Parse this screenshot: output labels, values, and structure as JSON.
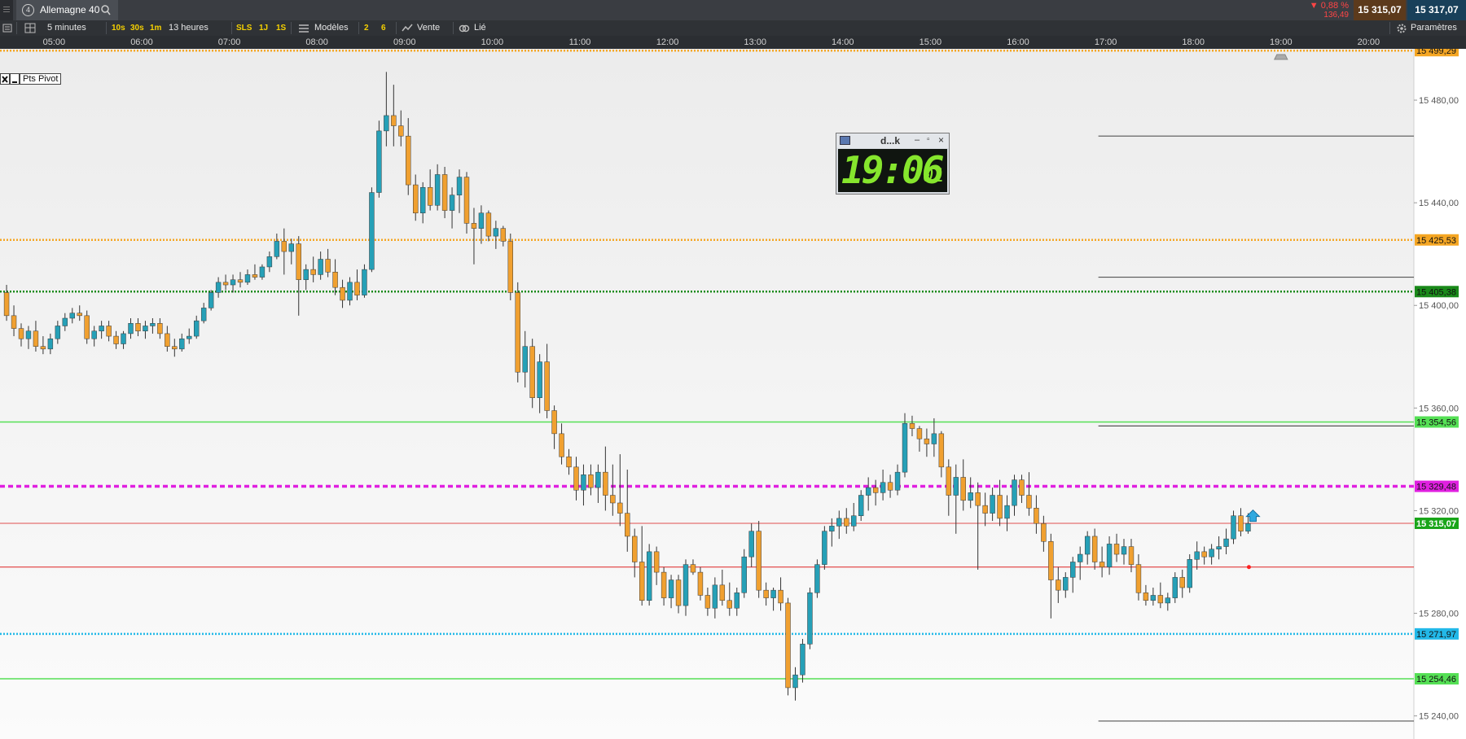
{
  "window": {
    "tab_number": "4",
    "instrument": "Allemagne 40",
    "change_percent": "▼ 0,88 %",
    "change_points": "136,49",
    "bid": "15 315,07",
    "ask": "15 317,07"
  },
  "toolbar": {
    "timeframe": "5 minutes",
    "quick_10s": "10s",
    "quick_30s": "30s",
    "quick_1m": "1m",
    "period": "13 heures",
    "sls": "SLS",
    "one_day": "1J",
    "one_s": "1S",
    "templates": "Modèles",
    "badge_2": "2",
    "badge_6": "6",
    "sell": "Vente",
    "linked": "Lié",
    "settings": "Paramètres"
  },
  "overlays": {
    "pivot_label": "Pts Pivot",
    "clock_title": "d...k",
    "clock_time": "19:06",
    "clock_seconds": "01"
  },
  "colors": {
    "bull": "#26a0b7",
    "bear": "#f0a030",
    "wick": "#333333",
    "background": "#f2f2f2",
    "axis_bg": "#2b2e32"
  },
  "chart_data": {
    "type": "candlestick",
    "instrument": "Allemagne 40",
    "interval": "5 minutes",
    "x_ticks": [
      "05:00",
      "06:00",
      "07:00",
      "08:00",
      "09:00",
      "10:00",
      "11:00",
      "12:00",
      "13:00",
      "14:00",
      "15:00",
      "16:00",
      "17:00",
      "18:00",
      "19:00",
      "20:00"
    ],
    "y_ticks": [
      15480,
      15440,
      15400,
      15360,
      15320,
      15280,
      15240
    ],
    "y_tick_labels": [
      "15 480,00",
      "15 440,00",
      "15 400,00",
      "15 360,00",
      "15 320,00",
      "15 280,00",
      "15 240,00"
    ],
    "ylim": [
      15231,
      15500
    ],
    "xlim": [
      "04:23",
      "20:31"
    ],
    "grid": false,
    "current_price": {
      "value": 15315.07,
      "label": "15 315,07",
      "color": "#19a519"
    },
    "levels": [
      {
        "value": 15499.29,
        "label": "15 499,29",
        "color": "#f5a623",
        "style": "dotted"
      },
      {
        "value": 15425.53,
        "label": "15 425,53",
        "color": "#f5a623",
        "style": "dotted"
      },
      {
        "value": 15405.38,
        "label": "15 405,38",
        "color": "#1a8a1a",
        "style": "dotted"
      },
      {
        "value": 15354.56,
        "label": "15 354,56",
        "color": "#55e055",
        "style": "solid"
      },
      {
        "value": 15329.48,
        "label": "15 329,48",
        "color": "#e020e0",
        "style": "dashed"
      },
      {
        "value": 15271.97,
        "label": "15 271,97",
        "color": "#22b8e8",
        "style": "dotted"
      },
      {
        "value": 15254.46,
        "label": "15 254,46",
        "color": "#55e055",
        "style": "solid"
      }
    ],
    "unlabeled_lines": [
      {
        "value": 15298,
        "color": "#dd2222"
      }
    ],
    "session_lines": [
      {
        "value": 15466,
        "from": "16:55",
        "to": "20:31"
      },
      {
        "value": 15411,
        "from": "16:55",
        "to": "20:31"
      },
      {
        "value": 15353,
        "from": "16:55",
        "to": "20:31"
      },
      {
        "value": 15238,
        "from": "16:55",
        "to": "20:31"
      }
    ],
    "ohlc": [
      [
        "04:25",
        15405,
        15408,
        15394,
        15396
      ],
      [
        "04:30",
        15396,
        15400,
        15388,
        15391
      ],
      [
        "04:35",
        15391,
        15393,
        15384,
        15387
      ],
      [
        "04:40",
        15387,
        15392,
        15383,
        15390
      ],
      [
        "04:45",
        15390,
        15394,
        15382,
        15384
      ],
      [
        "04:50",
        15384,
        15388,
        15381,
        15383
      ],
      [
        "04:55",
        15383,
        15389,
        15381,
        15387
      ],
      [
        "05:00",
        15387,
        15394,
        15385,
        15392
      ],
      [
        "05:05",
        15392,
        15397,
        15390,
        15395
      ],
      [
        "05:10",
        15395,
        15399,
        15393,
        15397
      ],
      [
        "05:15",
        15397,
        15400,
        15394,
        15396
      ],
      [
        "05:20",
        15396,
        15398,
        15385,
        15387
      ],
      [
        "05:25",
        15387,
        15392,
        15384,
        15390
      ],
      [
        "05:30",
        15390,
        15394,
        15387,
        15392
      ],
      [
        "05:35",
        15392,
        15394,
        15386,
        15388
      ],
      [
        "05:40",
        15388,
        15390,
        15383,
        15385
      ],
      [
        "05:45",
        15385,
        15390,
        15383,
        15389
      ],
      [
        "05:50",
        15389,
        15395,
        15387,
        15393
      ],
      [
        "05:55",
        15393,
        15395,
        15388,
        15390
      ],
      [
        "06:00",
        15390,
        15394,
        15387,
        15392
      ],
      [
        "06:05",
        15392,
        15395,
        15389,
        15393
      ],
      [
        "06:10",
        15393,
        15395,
        15387,
        15389
      ],
      [
        "06:15",
        15389,
        15392,
        15382,
        15384
      ],
      [
        "06:20",
        15384,
        15387,
        15380,
        15383
      ],
      [
        "06:25",
        15383,
        15389,
        15382,
        15387
      ],
      [
        "06:30",
        15387,
        15391,
        15385,
        15388
      ],
      [
        "06:35",
        15388,
        15396,
        15387,
        15394
      ],
      [
        "06:40",
        15394,
        15401,
        15393,
        15399
      ],
      [
        "06:45",
        15399,
        15406,
        15398,
        15405
      ],
      [
        "06:50",
        15405,
        15411,
        15403,
        15409
      ],
      [
        "06:55",
        15409,
        15412,
        15406,
        15408
      ],
      [
        "07:00",
        15408,
        15412,
        15405,
        15410
      ],
      [
        "07:05",
        15410,
        15413,
        15407,
        15409
      ],
      [
        "07:10",
        15409,
        15414,
        15408,
        15412
      ],
      [
        "07:15",
        15412,
        15416,
        15410,
        15411
      ],
      [
        "07:20",
        15411,
        15416,
        15410,
        15415
      ],
      [
        "07:25",
        15415,
        15421,
        15413,
        15419
      ],
      [
        "07:30",
        15419,
        15428,
        15418,
        15425
      ],
      [
        "07:35",
        15425,
        15430,
        15412,
        15421
      ],
      [
        "07:40",
        15421,
        15426,
        15416,
        15424
      ],
      [
        "07:45",
        15424,
        15427,
        15396,
        15410
      ],
      [
        "07:50",
        15410,
        15416,
        15406,
        15414
      ],
      [
        "07:55",
        15414,
        15419,
        15409,
        15412
      ],
      [
        "08:00",
        15412,
        15421,
        15410,
        15418
      ],
      [
        "08:05",
        15418,
        15422,
        15411,
        15413
      ],
      [
        "08:10",
        15413,
        15418,
        15404,
        15407
      ],
      [
        "08:15",
        15407,
        15410,
        15399,
        15402
      ],
      [
        "08:20",
        15402,
        15411,
        15400,
        15409
      ],
      [
        "08:25",
        15409,
        15414,
        15402,
        15404
      ],
      [
        "08:30",
        15404,
        15416,
        15403,
        15414
      ],
      [
        "08:35",
        15414,
        15446,
        15413,
        15444
      ],
      [
        "08:40",
        15444,
        15472,
        15442,
        15468
      ],
      [
        "08:45",
        15468,
        15491,
        15462,
        15474
      ],
      [
        "08:50",
        15474,
        15486,
        15462,
        15470
      ],
      [
        "08:55",
        15470,
        15476,
        15462,
        15466
      ],
      [
        "09:00",
        15466,
        15473,
        15443,
        15447
      ],
      [
        "09:05",
        15447,
        15451,
        15433,
        15436
      ],
      [
        "09:10",
        15436,
        15448,
        15432,
        15446
      ],
      [
        "09:15",
        15446,
        15453,
        15437,
        15439
      ],
      [
        "09:20",
        15439,
        15455,
        15437,
        15451
      ],
      [
        "09:25",
        15451,
        15454,
        15434,
        15437
      ],
      [
        "09:30",
        15437,
        15446,
        15430,
        15443
      ],
      [
        "09:35",
        15443,
        15453,
        15436,
        15450
      ],
      [
        "09:40",
        15450,
        15452,
        15428,
        15432
      ],
      [
        "09:45",
        15432,
        15438,
        15416,
        15430
      ],
      [
        "09:50",
        15430,
        15439,
        15424,
        15436
      ],
      [
        "09:55",
        15436,
        15437,
        15425,
        15427
      ],
      [
        "10:00",
        15427,
        15433,
        15422,
        15430
      ],
      [
        "10:05",
        15430,
        15431,
        15423,
        15425
      ],
      [
        "10:10",
        15425,
        15428,
        15402,
        15405
      ],
      [
        "10:15",
        15405,
        15409,
        15370,
        15374
      ],
      [
        "10:20",
        15374,
        15390,
        15368,
        15384
      ],
      [
        "10:25",
        15384,
        15387,
        15360,
        15364
      ],
      [
        "10:30",
        15364,
        15381,
        15358,
        15378
      ],
      [
        "10:35",
        15378,
        15385,
        15356,
        15359
      ],
      [
        "10:40",
        15359,
        15361,
        15344,
        15350
      ],
      [
        "10:45",
        15350,
        15354,
        15338,
        15341
      ],
      [
        "10:50",
        15341,
        15344,
        15334,
        15337
      ],
      [
        "10:55",
        15337,
        15341,
        15324,
        15328
      ],
      [
        "11:00",
        15328,
        15338,
        15322,
        15334
      ],
      [
        "11:05",
        15334,
        15338,
        15326,
        15329
      ],
      [
        "11:10",
        15329,
        15338,
        15323,
        15335
      ],
      [
        "11:15",
        15335,
        15345,
        15320,
        15326
      ],
      [
        "11:20",
        15326,
        15338,
        15318,
        15323
      ],
      [
        "11:25",
        15323,
        15342,
        15314,
        15319
      ],
      [
        "11:30",
        15319,
        15336,
        15304,
        15310
      ],
      [
        "11:35",
        15310,
        15313,
        15294,
        15300
      ],
      [
        "11:40",
        15300,
        15314,
        15283,
        15285
      ],
      [
        "11:45",
        15285,
        15307,
        15283,
        15304
      ],
      [
        "11:50",
        15304,
        15306,
        15291,
        15296
      ],
      [
        "11:55",
        15296,
        15298,
        15283,
        15286
      ],
      [
        "12:00",
        15286,
        15295,
        15282,
        15293
      ],
      [
        "12:05",
        15293,
        15295,
        15280,
        15283
      ],
      [
        "12:10",
        15283,
        15301,
        15279,
        15299
      ],
      [
        "12:15",
        15299,
        15301,
        15295,
        15296
      ],
      [
        "12:20",
        15296,
        15298,
        15285,
        15287
      ],
      [
        "12:25",
        15287,
        15290,
        15279,
        15282
      ],
      [
        "12:30",
        15282,
        15294,
        15278,
        15291
      ],
      [
        "12:35",
        15291,
        15297,
        15283,
        15285
      ],
      [
        "12:40",
        15285,
        15292,
        15279,
        15282
      ],
      [
        "12:45",
        15282,
        15290,
        15279,
        15288
      ],
      [
        "12:50",
        15288,
        15305,
        15286,
        15302
      ],
      [
        "12:55",
        15302,
        15315,
        15298,
        15312
      ],
      [
        "13:00",
        15312,
        15316,
        15286,
        15289
      ],
      [
        "13:05",
        15289,
        15292,
        15283,
        15286
      ],
      [
        "13:10",
        15286,
        15290,
        15281,
        15289
      ],
      [
        "13:15",
        15289,
        15294,
        15281,
        15284
      ],
      [
        "13:20",
        15284,
        15286,
        15248,
        15251
      ],
      [
        "13:25",
        15251,
        15259,
        15246,
        15256
      ],
      [
        "13:30",
        15256,
        15270,
        15253,
        15268
      ],
      [
        "13:35",
        15268,
        15290,
        15266,
        15288
      ],
      [
        "13:40",
        15288,
        15301,
        15286,
        15299
      ],
      [
        "13:45",
        15299,
        15314,
        15297,
        15312
      ],
      [
        "13:50",
        15312,
        15317,
        15306,
        15314
      ],
      [
        "13:55",
        15314,
        15320,
        15309,
        15317
      ],
      [
        "14:00",
        15317,
        15321,
        15311,
        15314
      ],
      [
        "14:05",
        15314,
        15323,
        15312,
        15318
      ],
      [
        "14:10",
        15318,
        15328,
        15316,
        15326
      ],
      [
        "14:15",
        15326,
        15333,
        15320,
        15329
      ],
      [
        "14:20",
        15329,
        15332,
        15322,
        15327
      ],
      [
        "14:25",
        15327,
        15336,
        15324,
        15331
      ],
      [
        "14:30",
        15331,
        15334,
        15325,
        15328
      ],
      [
        "14:35",
        15328,
        15338,
        15326,
        15335
      ],
      [
        "14:40",
        15335,
        15358,
        15333,
        15354
      ],
      [
        "14:45",
        15354,
        15357,
        15349,
        15352
      ],
      [
        "14:50",
        15352,
        15353,
        15343,
        15348
      ],
      [
        "14:55",
        15348,
        15352,
        15341,
        15346
      ],
      [
        "15:00",
        15346,
        15356,
        15341,
        15350
      ],
      [
        "15:05",
        15350,
        15351,
        15333,
        15337
      ],
      [
        "15:10",
        15337,
        15340,
        15318,
        15326
      ],
      [
        "15:15",
        15326,
        15338,
        15311,
        15333
      ],
      [
        "15:20",
        15333,
        15340,
        15320,
        15324
      ],
      [
        "15:25",
        15324,
        15333,
        15321,
        15327
      ],
      [
        "15:30",
        15327,
        15331,
        15297,
        15322
      ],
      [
        "15:35",
        15322,
        15327,
        15314,
        15319
      ],
      [
        "15:40",
        15319,
        15329,
        15316,
        15326
      ],
      [
        "15:45",
        15326,
        15332,
        15314,
        15317
      ],
      [
        "15:50",
        15317,
        15326,
        15312,
        15322
      ],
      [
        "15:55",
        15322,
        15334,
        15318,
        15332
      ],
      [
        "16:00",
        15332,
        15334,
        15323,
        15326
      ],
      [
        "16:05",
        15326,
        15335,
        15318,
        15321
      ],
      [
        "16:10",
        15321,
        15326,
        15311,
        15315
      ],
      [
        "16:15",
        15315,
        15318,
        15304,
        15308
      ],
      [
        "16:20",
        15308,
        15311,
        15278,
        15293
      ],
      [
        "16:25",
        15293,
        15298,
        15284,
        15289
      ],
      [
        "16:30",
        15289,
        15296,
        15286,
        15294
      ],
      [
        "16:35",
        15294,
        15302,
        15288,
        15300
      ],
      [
        "16:40",
        15300,
        15306,
        15293,
        15303
      ],
      [
        "16:45",
        15303,
        15312,
        15299,
        15310
      ],
      [
        "16:50",
        15310,
        15313,
        15297,
        15300
      ],
      [
        "16:55",
        15300,
        15306,
        15294,
        15298
      ],
      [
        "17:00",
        15298,
        15310,
        15295,
        15307
      ],
      [
        "17:05",
        15307,
        15311,
        15300,
        15303
      ],
      [
        "17:10",
        15303,
        15309,
        15299,
        15306
      ],
      [
        "17:15",
        15306,
        15309,
        15296,
        15299
      ],
      [
        "17:20",
        15299,
        15303,
        15285,
        15288
      ],
      [
        "17:25",
        15288,
        15291,
        15283,
        15285
      ],
      [
        "17:30",
        15285,
        15290,
        15283,
        15287
      ],
      [
        "17:35",
        15287,
        15292,
        15282,
        15284
      ],
      [
        "17:40",
        15284,
        15288,
        15281,
        15286
      ],
      [
        "17:45",
        15286,
        15296,
        15284,
        15294
      ],
      [
        "17:50",
        15294,
        15297,
        15286,
        15290
      ],
      [
        "17:55",
        15290,
        15303,
        15288,
        15301
      ],
      [
        "18:00",
        15301,
        15308,
        15297,
        15304
      ],
      [
        "18:05",
        15304,
        15306,
        15299,
        15302
      ],
      [
        "18:10",
        15302,
        15307,
        15299,
        15305
      ],
      [
        "18:15",
        15305,
        15310,
        15301,
        15306
      ],
      [
        "18:20",
        15306,
        15313,
        15303,
        15309
      ],
      [
        "18:25",
        15309,
        15320,
        15307,
        15318
      ],
      [
        "18:30",
        15318,
        15321,
        15310,
        15312
      ],
      [
        "18:35",
        15312,
        15319,
        15311,
        15315
      ]
    ]
  }
}
